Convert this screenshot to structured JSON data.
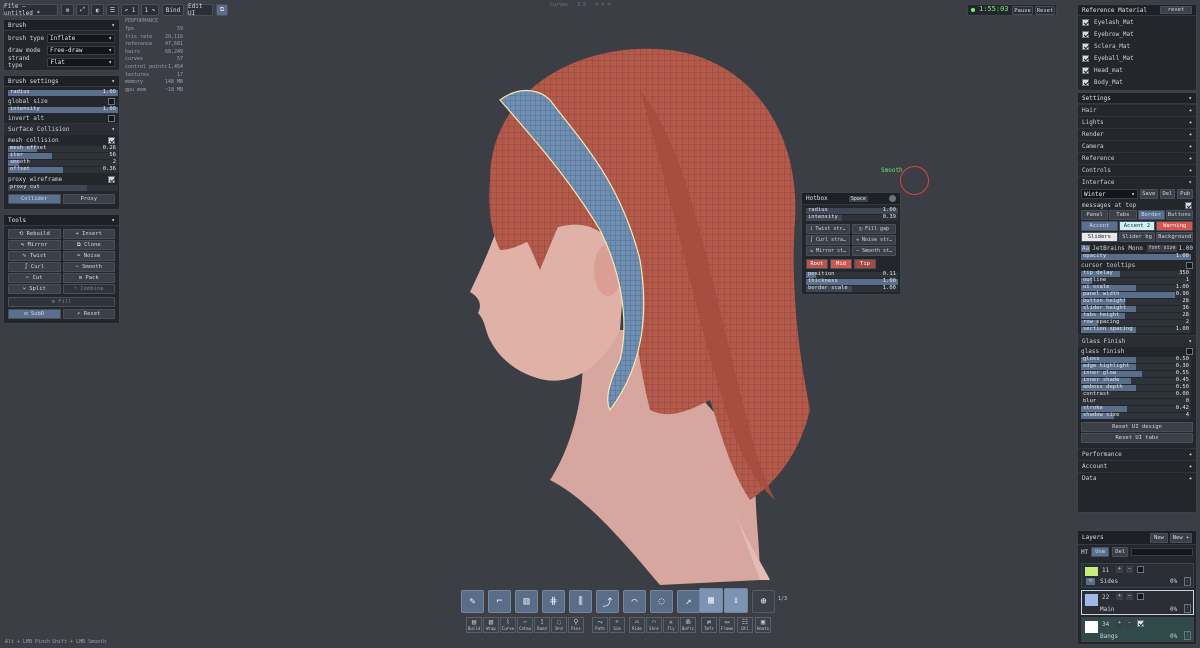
{
  "top": {
    "file": "File — untitled *",
    "buttons": [
      "⚙",
      "⤢",
      "◐",
      "☰",
      "↶ 1",
      "1 ↷",
      "Bind",
      "Edit UI",
      "⧉"
    ],
    "title_hint": "Curves · 3.8 · ⌘ ⌘ ⌘",
    "timer": "1:55:03",
    "pause": "Pause",
    "reset": "Reset"
  },
  "brush": {
    "title": "Brush",
    "fields": [
      {
        "label": "brush type",
        "value": "Inflate"
      },
      {
        "label": "draw mode",
        "value": "Free-draw"
      },
      {
        "label": "strand type",
        "value": "Flat"
      }
    ]
  },
  "brush_settings": {
    "title": "Brush settings",
    "radius_label": "radius",
    "radius_value": "1.00",
    "global_size": "global size",
    "intensity_label": "intensity",
    "intensity_value": "1.00",
    "invert_alt": "invert alt",
    "surface_collision": "Surface Collision",
    "mesh_collision": "mesh collision",
    "sliders": [
      {
        "label": "mesh offset",
        "value": "0.26",
        "fill": 0.26
      },
      {
        "label": "iter",
        "value": "56",
        "fill": 0.4
      },
      {
        "label": "smooth",
        "value": "2",
        "fill": 0.1
      },
      {
        "label": "offset",
        "value": "0.36",
        "fill": 0.5
      }
    ],
    "proxy_wireframe": "proxy wireframe",
    "proxy_cut": "proxy cut",
    "collider": "Collider",
    "proxy": "Proxy"
  },
  "performance": {
    "title": "PERFORMANCE",
    "stats": [
      {
        "k": "fps",
        "v": "59"
      },
      {
        "k": "tris rate",
        "v": "20,116"
      },
      {
        "k": "reference",
        "v": "47,681"
      },
      {
        "k": "hairs",
        "v": "68,249"
      },
      {
        "k": "curves",
        "v": "57"
      },
      {
        "k": "control points",
        "v": "1,454"
      },
      {
        "k": "textures",
        "v": "17"
      },
      {
        "k": "memory",
        "v": "148 MB"
      },
      {
        "k": "gpu mem",
        "v": "~18 MB"
      }
    ]
  },
  "tools": {
    "title": "Tools",
    "buttons": [
      [
        "⟲ Rebuild",
        "+ Insert"
      ],
      [
        "⇋ Mirror",
        "⧉ Clone"
      ],
      [
        "∿ Twist",
        "≈ Noise"
      ],
      [
        "∫ Curl",
        "∼ Smooth"
      ],
      [
        "✂ Cut",
        "⊡ Pack"
      ],
      [
        "⑂ Split",
        "⑃ Combine"
      ]
    ],
    "fill": "⊞ Fill",
    "subd": "⊟ SubD",
    "reset": "↶ Reset"
  },
  "cursor_label": "Smooth",
  "hotbox": {
    "title": "Hotbox",
    "space": "Space",
    "radius_label": "radius",
    "radius_value": "1.00",
    "intensity_label": "intensity",
    "intensity_value": "0.39",
    "buttons": [
      [
        "⟟ Twist str…",
        "◫ Fill gap"
      ],
      [
        "∫ Curl stra…",
        "≈ Noise str…"
      ],
      [
        "⇋ Mirror st…",
        "∼ Smooth st…"
      ]
    ],
    "tabs": [
      "Root",
      "Mid",
      "Tip"
    ],
    "sliders": [
      {
        "label": "position",
        "value": "0.11"
      },
      {
        "label": "thickness",
        "value": "1.00"
      },
      {
        "label": "border scale",
        "value": "1.00"
      }
    ]
  },
  "reference_material": {
    "title": "Reference Material",
    "reset": "reset",
    "items": [
      "Eyelash_Mat",
      "Eyebrow_Mat",
      "Sclera_Mat",
      "Eyeball_Mat",
      "Head_mat",
      "Body_Mat"
    ]
  },
  "settings": {
    "title": "Settings",
    "sections": [
      "Hair",
      "Lights",
      "Render",
      "Camera",
      "Reference",
      "Controls",
      "Interface"
    ],
    "theme": "Winter",
    "save": "Save",
    "del": "Del",
    "pub": "Pub",
    "messages_on_top": "messages at top",
    "tabs": [
      "Panel",
      "Tabs",
      "Border",
      "Buttons"
    ],
    "accent_row": [
      "Accent",
      "Accent 2",
      "Warning"
    ],
    "slider_row": [
      "Sliders",
      "Slider bg",
      "Background"
    ],
    "font_label": "JetBrains Mono",
    "font_size": "font size",
    "font_size_value": "1.00",
    "opacity": {
      "label": "opacity",
      "value": "1.00"
    },
    "cursor_tooltips": "cursor tooltips",
    "params": [
      {
        "label": "tip delay",
        "value": "350"
      },
      {
        "label": "outline",
        "value": "1"
      },
      {
        "label": "ui scale",
        "value": "1.00"
      },
      {
        "label": "panel width",
        "value": "0.90"
      },
      {
        "label": "button height",
        "value": "28"
      },
      {
        "label": "slider height",
        "value": "36"
      },
      {
        "label": "tabs height",
        "value": "28"
      },
      {
        "label": "row spacing",
        "value": "2"
      },
      {
        "label": "section spacing",
        "value": "1.00"
      }
    ],
    "glass_finish_section": "Glass Finish",
    "glass_finish": "glass finish",
    "glass": [
      {
        "label": "gloss",
        "value": "0.50",
        "fill": 0.5
      },
      {
        "label": "edge highlight",
        "value": "0.30",
        "fill": 0.5
      },
      {
        "label": "inner glow",
        "value": "0.55",
        "fill": 0.55
      },
      {
        "label": "inner shade",
        "value": "0.45",
        "fill": 0.45
      },
      {
        "label": "emboss depth",
        "value": "0.50",
        "fill": 0.5
      },
      {
        "label": "contrast",
        "value": "0.00",
        "fill": 0
      },
      {
        "label": "blur",
        "value": "0",
        "fill": 0
      },
      {
        "label": "stroke",
        "value": "0.42",
        "fill": 0.42
      },
      {
        "label": "shadow size",
        "value": "4",
        "fill": 0.3
      }
    ],
    "reset_design": "Reset UI design",
    "reset_tabs": "Reset UI tabs",
    "more": [
      "Performance",
      "Account",
      "Data"
    ]
  },
  "layers": {
    "title": "Layers",
    "new": "New",
    "new_plus": "New +",
    "mt": "MT",
    "use": "Use",
    "del": "Del",
    "items": [
      {
        "num": "11",
        "name": "Sides",
        "pct": "0%",
        "color": "#c8ec7e"
      },
      {
        "num": "22",
        "name": "Main",
        "pct": "0%",
        "color": "#9fb8e8"
      },
      {
        "num": "34",
        "name": "Bangs",
        "pct": "0%",
        "color": "#ffffff"
      }
    ]
  },
  "toolbar": {
    "main": [
      {
        "icon": "✎",
        "n": "1"
      },
      {
        "icon": "⌐",
        "n": "2"
      },
      {
        "icon": "▥",
        "n": "3"
      },
      {
        "icon": "⋕",
        "n": "4"
      },
      {
        "icon": "⫼",
        "n": "5"
      },
      {
        "icon": "⤴",
        "n": "6"
      },
      {
        "icon": "⌒",
        "n": "7"
      },
      {
        "icon": "◌",
        "n": "8"
      },
      {
        "icon": "↗",
        "n": "9"
      },
      {
        "icon": "▦",
        "n": ""
      },
      {
        "icon": "⇕",
        "n": ""
      },
      {
        "icon": "⊕",
        "n": ""
      }
    ],
    "page": "1/3",
    "secondary": [
      "Build",
      "Wrap",
      "Curve",
      "Catmu",
      "Rand",
      "Brd",
      "Pins",
      "Path",
      "Sim",
      "Ride",
      "Shre",
      "Fly",
      "Bufrc",
      "Tmfr",
      "Frame",
      "Dtl",
      "Heats"
    ]
  },
  "footer": {
    "hint1": "Alt + LMB Pinch",
    "hint2": "Shift + LMB Smooth"
  },
  "colors": {
    "bg": "#3b3e44",
    "panel": "#23262b",
    "accent": "#5a6e8c",
    "hair": "#b5574a",
    "headband": "#6f8db0",
    "skin": "#e4b4aa",
    "timer": "#7ef07a"
  }
}
